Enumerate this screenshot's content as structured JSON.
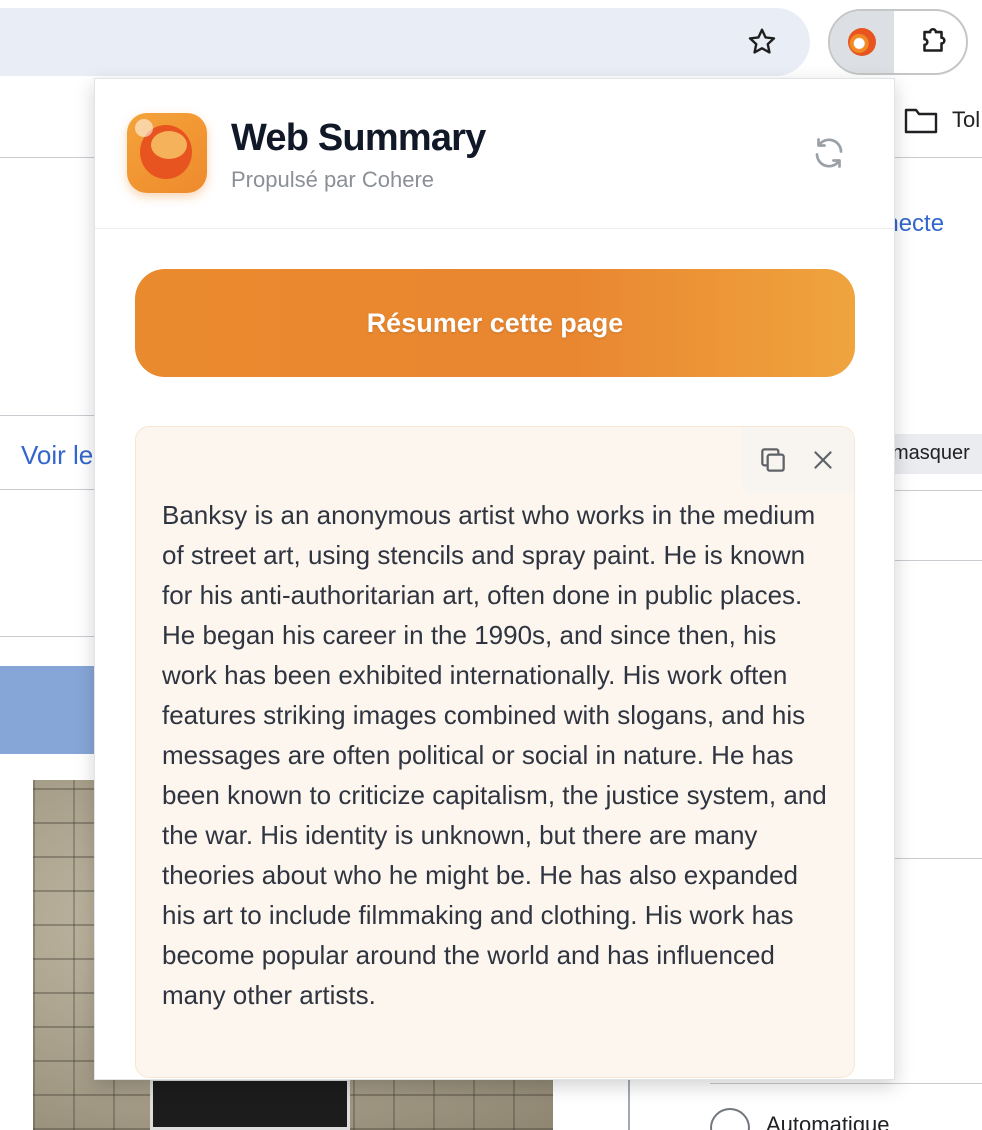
{
  "browser": {
    "bookmark_label": "Tol",
    "icons": {
      "star": "star-icon",
      "extension": "web-summary-extension-icon",
      "puzzle": "puzzle-icon",
      "folder": "folder-icon"
    }
  },
  "background_page": {
    "link_right": "nnecte",
    "voir_link": "Voir le",
    "masquer_button": "masquer",
    "radio_label": "Automatique"
  },
  "popup": {
    "title": "Web Summary",
    "subtitle": "Propulsé par Cohere",
    "summarize_button": "Résumer cette page",
    "summary": "Banksy is an anonymous artist who works in the medium of street art, using stencils and spray paint. He is known for his anti-authoritarian art, often done in public places. He began his career in the 1990s, and since then, his work has been exhibited internationally. His work often features striking images combined with slogans, and his messages are often political or social in nature. He has been known to criticize capitalism, the justice system, and the war. His identity is unknown, but there are many theories about who he might be. He has also expanded his art to include filmmaking and clothing. His work has become popular around the world and has influenced many other artists.",
    "icons": {
      "logo": "web-summary-logo-icon",
      "refresh": "refresh-icon",
      "copy": "copy-icon",
      "close": "close-icon"
    },
    "colors": {
      "accent": "#ea8a2e",
      "accent_light": "#efa43e",
      "card_background": "#fdf6ee",
      "title": "#111827",
      "subtitle": "#8b8f96"
    }
  }
}
